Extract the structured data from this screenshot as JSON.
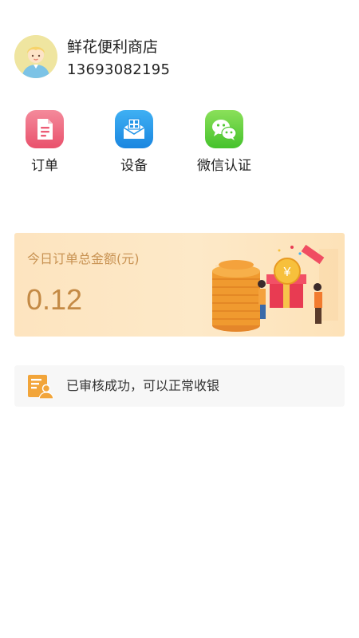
{
  "profile": {
    "store_name": "鲜花便利商店",
    "phone": "13693082195",
    "avatar_icon": "user-avatar-icon"
  },
  "menu": {
    "items": [
      {
        "label": "订单",
        "icon": "order-document-icon",
        "color": "#ec5c76"
      },
      {
        "label": "设备",
        "icon": "device-box-icon",
        "color": "#2596e8"
      },
      {
        "label": "微信认证",
        "icon": "wechat-icon",
        "color": "#52c934"
      }
    ]
  },
  "banner": {
    "title": "今日订单总金额(元)",
    "amount": "0.12",
    "coin_symbol": "¥",
    "accent_color": "#c48a45"
  },
  "notice": {
    "text": "已审核成功，可以正常收银",
    "icon": "verified-user-card-icon",
    "icon_color": "#f2a53a"
  }
}
